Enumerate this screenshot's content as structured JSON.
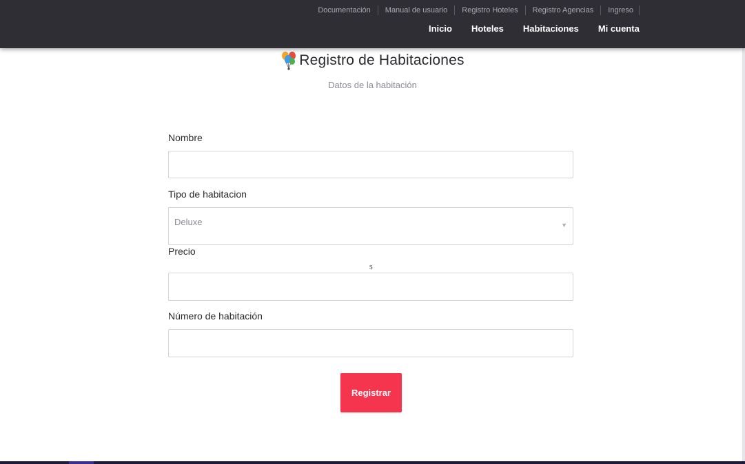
{
  "header": {
    "util_links": [
      "Documentación",
      "Manual de usuario",
      "Registro Hoteles",
      "Registro Agencias",
      "Ingreso"
    ],
    "main_links": [
      "Inicio",
      "Hoteles",
      "Habitaciones",
      "Mi cuenta"
    ],
    "background": "#2e2e34"
  },
  "page": {
    "title": "Registro de Habitaciones",
    "subtitle": "Datos de la habitación",
    "icon": "balloons-icon"
  },
  "form": {
    "nombre_label": "Nombre",
    "nombre_value": "",
    "tipo_label": "Tipo de habitacion",
    "tipo_value": "Deluxe",
    "precio_label": "Precio",
    "precio_currency": "$",
    "precio_value": "",
    "numero_label": "Número de habitación",
    "numero_value": "",
    "submit_label": "Registrar",
    "submit_color": "#f5344e"
  }
}
